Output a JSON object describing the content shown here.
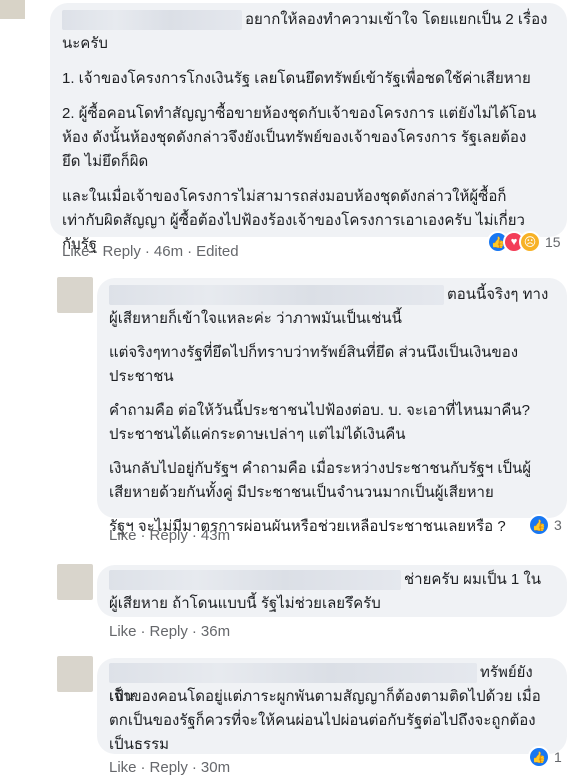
{
  "comments": [
    {
      "text_first": "อยากให้ลองทำความเข้าใจ โดยแยกเป็น 2 เรื่อง",
      "lines": [
        "นะครับ",
        "1. เจ้าของโครงการโกงเงินรัฐ เลยโดนยึดทรัพย์เข้ารัฐเพื่อชดใช้ค่าเสียหาย",
        "2. ผู้ซื้อคอนโดทำสัญญาซื้อขายห้องชุดกับเจ้าของโครงการ แต่ยังไม่ได้โอน",
        "ห้อง ดังนั้นห้องชุดดังกล่าวจึงยังเป็นทรัพย์ของเจ้าของโครงการ รัฐเลยต้อง",
        "ยึด ไม่ยึดก็ผิด",
        "และในเมื่อเจ้าของโครงการไม่สามารถส่งมอบห้องชุดดังกล่าวให้ผู้ซื้อก็",
        "เท่ากับผิดสัญญา ผู้ซื้อต้องไปฟ้องร้องเจ้าของโครงการเอาเองครับ ไม่เกี่ยว",
        "กับรัฐ"
      ],
      "like": "Like",
      "reply": "Reply",
      "time": "46m",
      "edited": "Edited",
      "reaction_count": "15"
    },
    {
      "text_first": "ตอนนี้จริงๆ ทาง",
      "lines": [
        "ผู้เสียหายก็เข้าใจแหละค่ะ ว่าภาพมันเป็นเช่นนี้",
        "แต่จริงๆทางรัฐที่ยึดไปก็ทราบว่าทรัพย์สินที่ยึด ส่วนนึงเป็นเงินของ",
        "ประชาชน",
        "คำถามคือ ต่อให้วันนี้ประชาชนไปฟ้องต่อบ. บ. จะเอาที่ไหนมาคืน?",
        "ประชาชนได้แค่กระดาษเปล่าๆ แต่ไม่ได้เงินคืน",
        "เงินกลับไปอยู่กับรัฐฯ คำถามคือ เมื่อระหว่างประชาชนกับรัฐฯ เป็นผู้",
        "เสียหายด้วยกันทั้งคู่ มีประชาชนเป็นจำนวนมากเป็นผู้เสียหาย",
        "รัฐฯ จะไม่มีมาตรการผ่อนผันหรือช่วยเหลือประชาชนเลยหรือ ?"
      ],
      "like": "Like",
      "reply": "Reply",
      "time": "43m",
      "reaction_count": "3"
    },
    {
      "text_first": "ช่ายครับ ผมเป็น 1 ใน",
      "lines": [
        "ผู้เสียหาย ถ้าโดนแบบนี้ รัฐไม่ช่วยเลยรึครับ"
      ],
      "like": "Like",
      "reply": "Reply",
      "time": "36m"
    },
    {
      "text_first": "ทรัพย์ยังเป็น",
      "lines": [
        "เจ้าของคอนโดอยู่แต่ภาระผูกพันตามสัญญาก็ต้องตามติดไปด้วย เมื่อ",
        "ตกเป็นของรัฐก็ควรที่จะให้คนผ่อนไปผ่อนต่อกับรัฐต่อไปถึงจะถูกต้อง",
        "เป็นธรรม"
      ],
      "like": "Like",
      "reply": "Reply",
      "time": "30m",
      "reaction_count": "1"
    }
  ],
  "icons": {
    "like": "thumbs-up-icon",
    "love": "heart-icon",
    "sad": "sad-face-icon"
  },
  "colors": {
    "bubble": "#f0f2f5",
    "meta": "#65676b",
    "like_blue": "#1877f2",
    "love_red": "#f33e58",
    "sad_yellow": "#f7b125"
  }
}
